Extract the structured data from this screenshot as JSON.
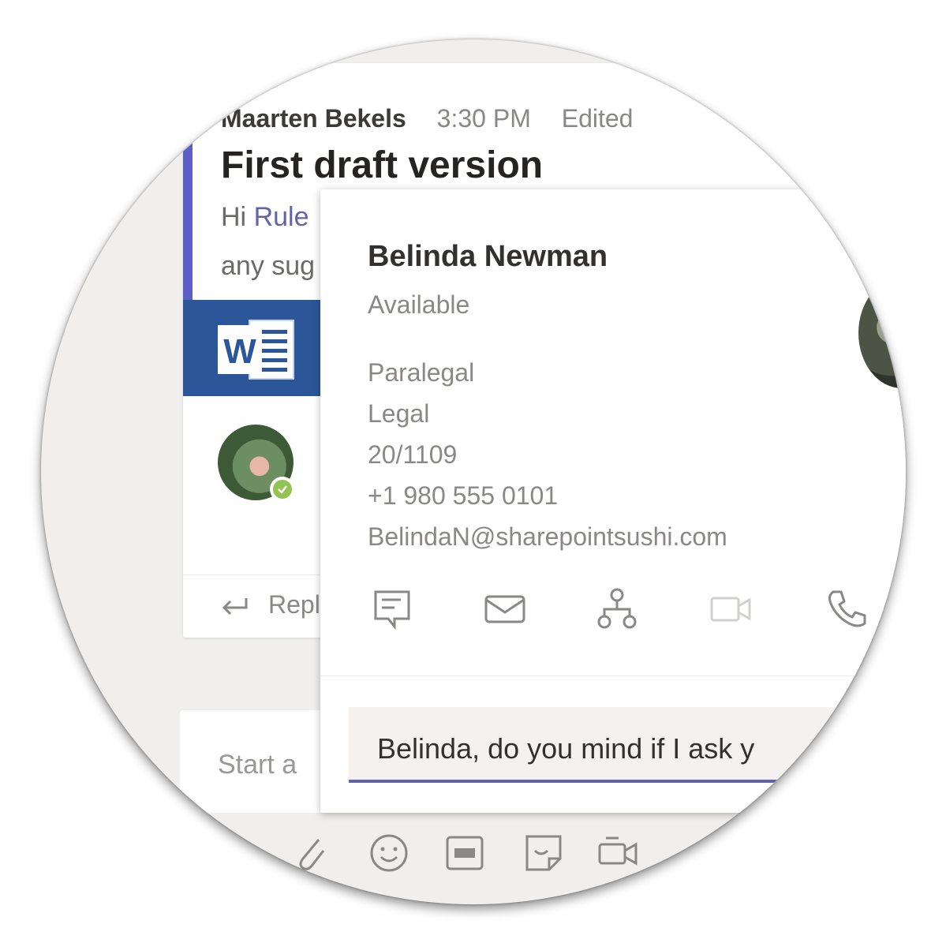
{
  "message": {
    "author": "Maarten Bekels",
    "time": "3:30 PM",
    "edited": "Edited",
    "subject": "First draft version",
    "body_greeting": "Hi ",
    "body_mention": "Rule",
    "body_line2": "any sug",
    "reply_label": "Repl"
  },
  "compose": {
    "placeholder": "Start a"
  },
  "profile_card": {
    "name": "Belinda Newman",
    "status": "Available",
    "job_title": "Paralegal",
    "department": "Legal",
    "office": "20/1109",
    "phone": "+1 980 555 0101",
    "email": "BelindaN@sharepointsushi.com",
    "chat_input": "Belinda, do you mind if I ask y"
  },
  "colors": {
    "accent": "#5b5fc7",
    "word_blue": "#2b579a",
    "presence_available": "#92c353",
    "input_underline": "#6264a7"
  },
  "icons": {
    "profile_actions": [
      "chat-icon",
      "mail-icon",
      "org-chart-icon",
      "video-call-icon",
      "phone-icon"
    ],
    "compose_toolbar": [
      "attach-icon",
      "emoji-icon",
      "gif-icon",
      "sticker-icon",
      "meet-now-icon"
    ]
  }
}
